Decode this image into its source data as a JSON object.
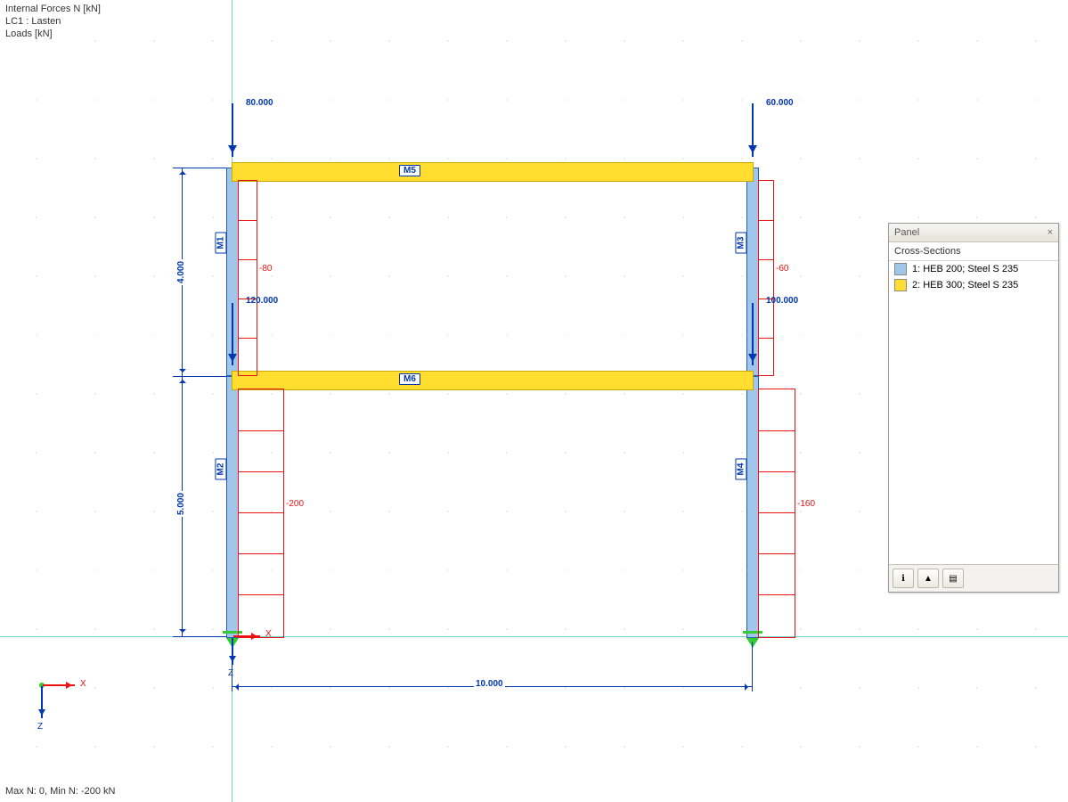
{
  "header": {
    "title": "Internal Forces N [kN]",
    "loadcase": "LC1 : Lasten",
    "loads_unit": "Loads [kN]"
  },
  "footer": {
    "summary": "Max N: 0, Min N: -200 kN"
  },
  "dimensions": {
    "width": "10.000",
    "upper": "4.000",
    "lower": "5.000"
  },
  "loads": {
    "top_left": "80.000",
    "top_right": "60.000",
    "mid_left": "120.000",
    "mid_right": "100.000"
  },
  "results": {
    "upper_left": "-80",
    "upper_right": "-60",
    "lower_left": "-200",
    "lower_right": "-160"
  },
  "members": {
    "m1": "M1",
    "m2": "M2",
    "m3": "M3",
    "m4": "M4",
    "m5": "M5",
    "m6": "M6"
  },
  "axes": {
    "x": "X",
    "z": "Z"
  },
  "panel": {
    "title": "Panel",
    "section_header": "Cross-Sections",
    "items": [
      {
        "color": "#a1c6ec",
        "label": "1: HEB 200; Steel S 235"
      },
      {
        "color": "#ffde2f",
        "label": "2: HEB 300; Steel S 235"
      }
    ]
  },
  "colors": {
    "blue": "#0038ae",
    "red": "#e11",
    "yellow": "#ffde2f",
    "col": "#a1c6ec",
    "teal": "#73d6cc"
  }
}
